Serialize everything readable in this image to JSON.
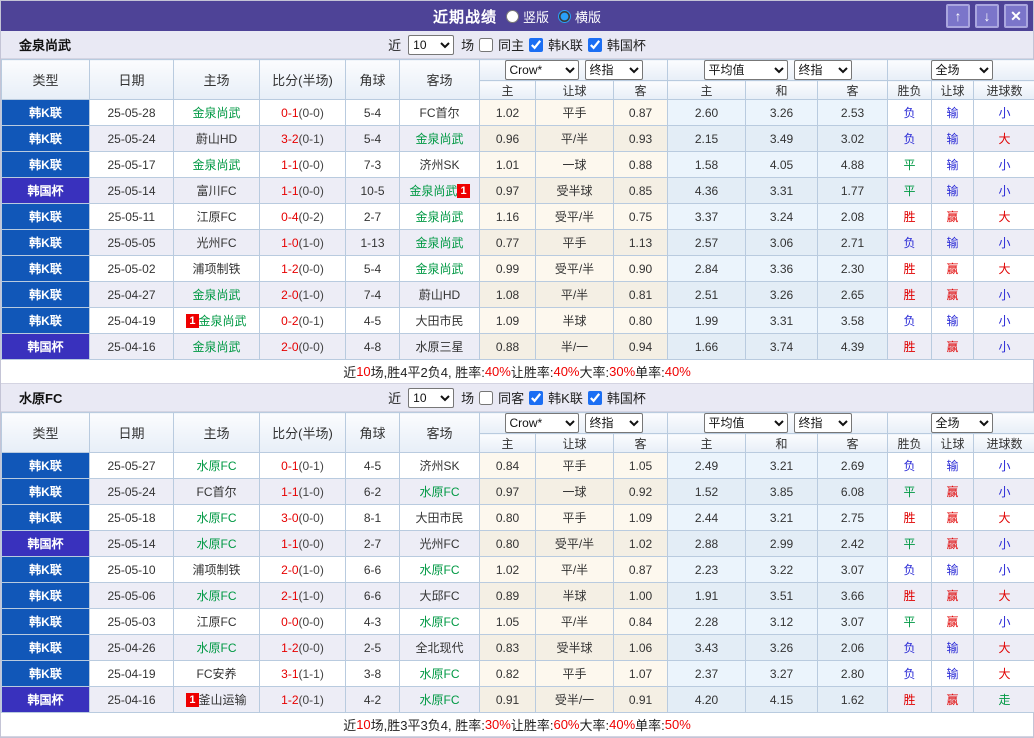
{
  "titlebar": {
    "title": "近期战绩",
    "radio_vertical": "竖版",
    "radio_horizontal": "横版",
    "vertical_checked": false,
    "horizontal_checked": true,
    "up_glyph": "↑",
    "down_glyph": "↓",
    "close_glyph": "✕"
  },
  "filter": {
    "prefix": "近",
    "matches": "10",
    "suffix": "场",
    "league_k": "韩K联",
    "cup": "韩国杯"
  },
  "table": {
    "main_headers": [
      "类型",
      "日期",
      "主场",
      "比分(半场)",
      "角球",
      "客场"
    ],
    "odds_dropdown": "Crow*",
    "odds_stage_dropdown": "终指",
    "avg_dropdown": "平均值",
    "avg_stage_dropdown": "终指",
    "scope_dropdown": "全场",
    "odds_subheaders": [
      "主",
      "让球",
      "客"
    ],
    "avg_subheaders": [
      "主",
      "和",
      "客"
    ],
    "result_subheaders": [
      "胜负",
      "让球",
      "进球数"
    ]
  },
  "colors": {
    "accent_purple": "#4e4397",
    "league_blue": "#1157b8",
    "cup_indigo": "#3931bd",
    "self_green": "#009944",
    "score_red": "#e60000",
    "win_red": "#e00000",
    "lose_blue": "#2929d6"
  },
  "sections": [
    {
      "team": "金泉尚武",
      "same_label": "同主",
      "same_checked": false,
      "league_checked": true,
      "cup_checked": true,
      "rows": [
        {
          "type": "韩K联",
          "date": "25-05-28",
          "home": {
            "name": "金泉尚武",
            "self": true
          },
          "score": "0-1",
          "half": "(0-0)",
          "corner": "5-4",
          "away": {
            "name": "FC首尔",
            "self": false
          },
          "odds": [
            "1.02",
            "平手",
            "0.87"
          ],
          "avg": [
            "2.60",
            "3.26",
            "2.53"
          ],
          "res": [
            [
              "负",
              "b"
            ],
            [
              "输",
              "b"
            ],
            [
              "小",
              "b"
            ]
          ]
        },
        {
          "type": "韩K联",
          "date": "25-05-24",
          "home": {
            "name": "蔚山HD",
            "self": false
          },
          "score": "3-2",
          "half": "(0-1)",
          "corner": "5-4",
          "away": {
            "name": "金泉尚武",
            "self": true
          },
          "odds": [
            "0.96",
            "平/半",
            "0.93"
          ],
          "avg": [
            "2.15",
            "3.49",
            "3.02"
          ],
          "res": [
            [
              "负",
              "b"
            ],
            [
              "输",
              "b"
            ],
            [
              "大",
              "r"
            ]
          ]
        },
        {
          "type": "韩K联",
          "date": "25-05-17",
          "home": {
            "name": "金泉尚武",
            "self": true
          },
          "score": "1-1",
          "half": "(0-0)",
          "corner": "7-3",
          "away": {
            "name": "济州SK",
            "self": false
          },
          "odds": [
            "1.01",
            "一球",
            "0.88"
          ],
          "avg": [
            "1.58",
            "4.05",
            "4.88"
          ],
          "res": [
            [
              "平",
              "g"
            ],
            [
              "输",
              "b"
            ],
            [
              "小",
              "b"
            ]
          ]
        },
        {
          "type": "韩国杯",
          "date": "25-05-14",
          "home": {
            "name": "富川FC",
            "self": false
          },
          "score": "1-1",
          "half": "(0-0)",
          "corner": "10-5",
          "away": {
            "name": "金泉尚武",
            "self": true,
            "badge": "1",
            "badge_pos": "after"
          },
          "odds": [
            "0.97",
            "受半球",
            "0.85"
          ],
          "avg": [
            "4.36",
            "3.31",
            "1.77"
          ],
          "res": [
            [
              "平",
              "g"
            ],
            [
              "输",
              "b"
            ],
            [
              "小",
              "b"
            ]
          ]
        },
        {
          "type": "韩K联",
          "date": "25-05-11",
          "home": {
            "name": "江原FC",
            "self": false
          },
          "score": "0-4",
          "half": "(0-2)",
          "corner": "2-7",
          "away": {
            "name": "金泉尚武",
            "self": true
          },
          "odds": [
            "1.16",
            "受平/半",
            "0.75"
          ],
          "avg": [
            "3.37",
            "3.24",
            "2.08"
          ],
          "res": [
            [
              "胜",
              "r"
            ],
            [
              "赢",
              "r"
            ],
            [
              "大",
              "r"
            ]
          ]
        },
        {
          "type": "韩K联",
          "date": "25-05-05",
          "home": {
            "name": "光州FC",
            "self": false
          },
          "score": "1-0",
          "half": "(1-0)",
          "corner": "1-13",
          "away": {
            "name": "金泉尚武",
            "self": true
          },
          "odds": [
            "0.77",
            "平手",
            "1.13"
          ],
          "avg": [
            "2.57",
            "3.06",
            "2.71"
          ],
          "res": [
            [
              "负",
              "b"
            ],
            [
              "输",
              "b"
            ],
            [
              "小",
              "b"
            ]
          ]
        },
        {
          "type": "韩K联",
          "date": "25-05-02",
          "home": {
            "name": "浦项制铁",
            "self": false
          },
          "score": "1-2",
          "half": "(0-0)",
          "corner": "5-4",
          "away": {
            "name": "金泉尚武",
            "self": true
          },
          "odds": [
            "0.99",
            "受平/半",
            "0.90"
          ],
          "avg": [
            "2.84",
            "3.36",
            "2.30"
          ],
          "res": [
            [
              "胜",
              "r"
            ],
            [
              "赢",
              "r"
            ],
            [
              "大",
              "r"
            ]
          ]
        },
        {
          "type": "韩K联",
          "date": "25-04-27",
          "home": {
            "name": "金泉尚武",
            "self": true
          },
          "score": "2-0",
          "half": "(1-0)",
          "corner": "7-4",
          "away": {
            "name": "蔚山HD",
            "self": false
          },
          "odds": [
            "1.08",
            "平/半",
            "0.81"
          ],
          "avg": [
            "2.51",
            "3.26",
            "2.65"
          ],
          "res": [
            [
              "胜",
              "r"
            ],
            [
              "赢",
              "r"
            ],
            [
              "小",
              "b"
            ]
          ]
        },
        {
          "type": "韩K联",
          "date": "25-04-19",
          "home": {
            "name": "金泉尚武",
            "self": true,
            "badge": "1",
            "badge_pos": "before"
          },
          "score": "0-2",
          "half": "(0-1)",
          "corner": "4-5",
          "away": {
            "name": "大田市民",
            "self": false
          },
          "odds": [
            "1.09",
            "半球",
            "0.80"
          ],
          "avg": [
            "1.99",
            "3.31",
            "3.58"
          ],
          "res": [
            [
              "负",
              "b"
            ],
            [
              "输",
              "b"
            ],
            [
              "小",
              "b"
            ]
          ]
        },
        {
          "type": "韩国杯",
          "date": "25-04-16",
          "home": {
            "name": "金泉尚武",
            "self": true
          },
          "score": "2-0",
          "half": "(0-0)",
          "corner": "4-8",
          "away": {
            "name": "水原三星",
            "self": false
          },
          "odds": [
            "0.88",
            "半/一",
            "0.94"
          ],
          "avg": [
            "1.66",
            "3.74",
            "4.39"
          ],
          "res": [
            [
              "胜",
              "r"
            ],
            [
              "赢",
              "r"
            ],
            [
              "小",
              "b"
            ]
          ]
        }
      ],
      "summary": [
        {
          "t": "近",
          "c": "k"
        },
        {
          "t": "10",
          "c": "r"
        },
        {
          "t": "场,胜4平2负4, 胜率:",
          "c": "k"
        },
        {
          "t": "40%",
          "c": "r"
        },
        {
          "t": " 让胜率:",
          "c": "k"
        },
        {
          "t": "40%",
          "c": "r"
        },
        {
          "t": " 大率:",
          "c": "k"
        },
        {
          "t": "30%",
          "c": "r"
        },
        {
          "t": " 单率:",
          "c": "k"
        },
        {
          "t": "40%",
          "c": "r"
        }
      ]
    },
    {
      "team": "水原FC",
      "same_label": "同客",
      "same_checked": false,
      "league_checked": true,
      "cup_checked": true,
      "rows": [
        {
          "type": "韩K联",
          "date": "25-05-27",
          "home": {
            "name": "水原FC",
            "self": true
          },
          "score": "0-1",
          "half": "(0-1)",
          "corner": "4-5",
          "away": {
            "name": "济州SK",
            "self": false
          },
          "odds": [
            "0.84",
            "平手",
            "1.05"
          ],
          "avg": [
            "2.49",
            "3.21",
            "2.69"
          ],
          "res": [
            [
              "负",
              "b"
            ],
            [
              "输",
              "b"
            ],
            [
              "小",
              "b"
            ]
          ]
        },
        {
          "type": "韩K联",
          "date": "25-05-24",
          "home": {
            "name": "FC首尔",
            "self": false
          },
          "score": "1-1",
          "half": "(1-0)",
          "corner": "6-2",
          "away": {
            "name": "水原FC",
            "self": true
          },
          "odds": [
            "0.97",
            "一球",
            "0.92"
          ],
          "avg": [
            "1.52",
            "3.85",
            "6.08"
          ],
          "res": [
            [
              "平",
              "g"
            ],
            [
              "赢",
              "r"
            ],
            [
              "小",
              "b"
            ]
          ]
        },
        {
          "type": "韩K联",
          "date": "25-05-18",
          "home": {
            "name": "水原FC",
            "self": true
          },
          "score": "3-0",
          "half": "(0-0)",
          "corner": "8-1",
          "away": {
            "name": "大田市民",
            "self": false
          },
          "odds": [
            "0.80",
            "平手",
            "1.09"
          ],
          "avg": [
            "2.44",
            "3.21",
            "2.75"
          ],
          "res": [
            [
              "胜",
              "r"
            ],
            [
              "赢",
              "r"
            ],
            [
              "大",
              "r"
            ]
          ]
        },
        {
          "type": "韩国杯",
          "date": "25-05-14",
          "home": {
            "name": "水原FC",
            "self": true
          },
          "score": "1-1",
          "half": "(0-0)",
          "corner": "2-7",
          "away": {
            "name": "光州FC",
            "self": false
          },
          "odds": [
            "0.80",
            "受平/半",
            "1.02"
          ],
          "avg": [
            "2.88",
            "2.99",
            "2.42"
          ],
          "res": [
            [
              "平",
              "g"
            ],
            [
              "赢",
              "r"
            ],
            [
              "小",
              "b"
            ]
          ]
        },
        {
          "type": "韩K联",
          "date": "25-05-10",
          "home": {
            "name": "浦项制铁",
            "self": false
          },
          "score": "2-0",
          "half": "(1-0)",
          "corner": "6-6",
          "away": {
            "name": "水原FC",
            "self": true
          },
          "odds": [
            "1.02",
            "平/半",
            "0.87"
          ],
          "avg": [
            "2.23",
            "3.22",
            "3.07"
          ],
          "res": [
            [
              "负",
              "b"
            ],
            [
              "输",
              "b"
            ],
            [
              "小",
              "b"
            ]
          ]
        },
        {
          "type": "韩K联",
          "date": "25-05-06",
          "home": {
            "name": "水原FC",
            "self": true
          },
          "score": "2-1",
          "half": "(1-0)",
          "corner": "6-6",
          "away": {
            "name": "大邱FC",
            "self": false
          },
          "odds": [
            "0.89",
            "半球",
            "1.00"
          ],
          "avg": [
            "1.91",
            "3.51",
            "3.66"
          ],
          "res": [
            [
              "胜",
              "r"
            ],
            [
              "赢",
              "r"
            ],
            [
              "大",
              "r"
            ]
          ]
        },
        {
          "type": "韩K联",
          "date": "25-05-03",
          "home": {
            "name": "江原FC",
            "self": false
          },
          "score": "0-0",
          "half": "(0-0)",
          "corner": "4-3",
          "away": {
            "name": "水原FC",
            "self": true
          },
          "odds": [
            "1.05",
            "平/半",
            "0.84"
          ],
          "avg": [
            "2.28",
            "3.12",
            "3.07"
          ],
          "res": [
            [
              "平",
              "g"
            ],
            [
              "赢",
              "r"
            ],
            [
              "小",
              "b"
            ]
          ]
        },
        {
          "type": "韩K联",
          "date": "25-04-26",
          "home": {
            "name": "水原FC",
            "self": true
          },
          "score": "1-2",
          "half": "(0-0)",
          "corner": "2-5",
          "away": {
            "name": "全北现代",
            "self": false
          },
          "odds": [
            "0.83",
            "受半球",
            "1.06"
          ],
          "avg": [
            "3.43",
            "3.26",
            "2.06"
          ],
          "res": [
            [
              "负",
              "b"
            ],
            [
              "输",
              "b"
            ],
            [
              "大",
              "r"
            ]
          ]
        },
        {
          "type": "韩K联",
          "date": "25-04-19",
          "home": {
            "name": "FC安养",
            "self": false
          },
          "score": "3-1",
          "half": "(1-1)",
          "corner": "3-8",
          "away": {
            "name": "水原FC",
            "self": true
          },
          "odds": [
            "0.82",
            "平手",
            "1.07"
          ],
          "avg": [
            "2.37",
            "3.27",
            "2.80"
          ],
          "res": [
            [
              "负",
              "b"
            ],
            [
              "输",
              "b"
            ],
            [
              "大",
              "r"
            ]
          ]
        },
        {
          "type": "韩国杯",
          "date": "25-04-16",
          "home": {
            "name": "釜山运输",
            "self": false,
            "badge": "1",
            "badge_pos": "before"
          },
          "score": "1-2",
          "half": "(0-1)",
          "corner": "4-2",
          "away": {
            "name": "水原FC",
            "self": true
          },
          "odds": [
            "0.91",
            "受半/一",
            "0.91"
          ],
          "avg": [
            "4.20",
            "4.15",
            "1.62"
          ],
          "res": [
            [
              "胜",
              "r"
            ],
            [
              "赢",
              "r"
            ],
            [
              "走",
              "g"
            ]
          ]
        }
      ],
      "summary": [
        {
          "t": "近",
          "c": "k"
        },
        {
          "t": "10",
          "c": "r"
        },
        {
          "t": "场,胜3平3负4, 胜率:",
          "c": "k"
        },
        {
          "t": "30%",
          "c": "r"
        },
        {
          "t": " 让胜率:",
          "c": "k"
        },
        {
          "t": "60%",
          "c": "r"
        },
        {
          "t": " 大率:",
          "c": "k"
        },
        {
          "t": "40%",
          "c": "r"
        },
        {
          "t": " 单率:",
          "c": "k"
        },
        {
          "t": "50%",
          "c": "r"
        }
      ]
    }
  ]
}
